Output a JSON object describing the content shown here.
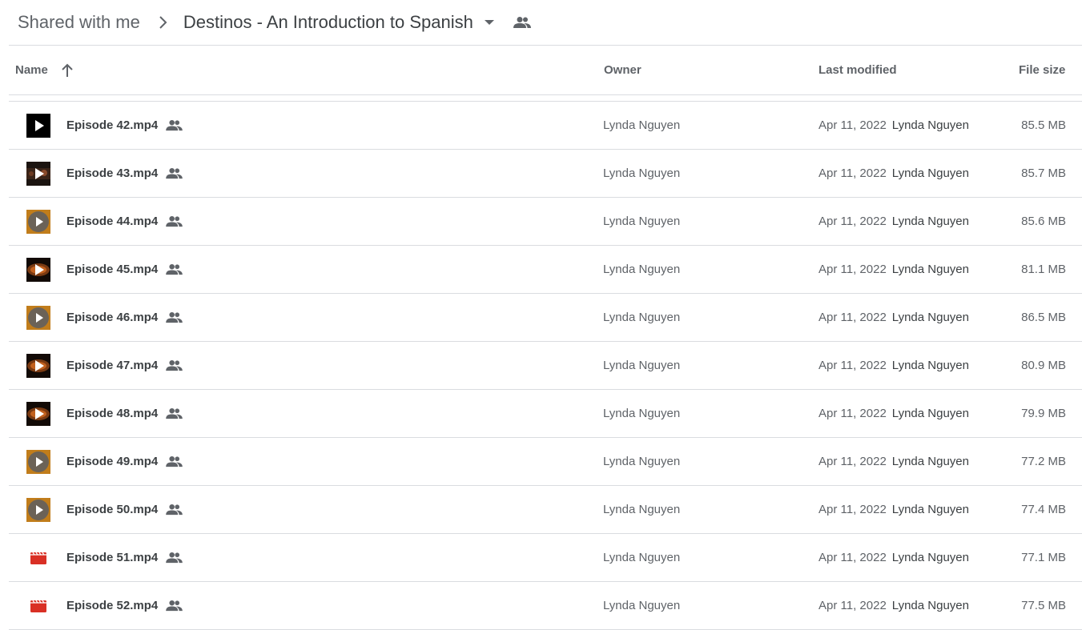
{
  "breadcrumb": {
    "root": "Shared with me",
    "current": "Destinos - An Introduction to Spanish"
  },
  "columns": {
    "name": "Name",
    "owner": "Owner",
    "last_modified": "Last modified",
    "file_size": "File size"
  },
  "icons": {
    "chevron": "chevron-right-icon",
    "dropdown": "arrow-drop-down-icon",
    "shared": "people-icon",
    "sort": "arrow-up-icon"
  },
  "files": [
    {
      "name": "Episode 42.mp4",
      "owner": "Lynda Nguyen",
      "date": "Apr 11, 2022",
      "by": "Lynda Nguyen",
      "size": "85.5 MB",
      "thumb": "black"
    },
    {
      "name": "Episode 43.mp4",
      "owner": "Lynda Nguyen",
      "date": "Apr 11, 2022",
      "by": "Lynda Nguyen",
      "size": "85.7 MB",
      "thumb": "scene"
    },
    {
      "name": "Episode 44.mp4",
      "owner": "Lynda Nguyen",
      "date": "Apr 11, 2022",
      "by": "Lynda Nguyen",
      "size": "85.6 MB",
      "thumb": "gold-circle"
    },
    {
      "name": "Episode 45.mp4",
      "owner": "Lynda Nguyen",
      "date": "Apr 11, 2022",
      "by": "Lynda Nguyen",
      "size": "81.1 MB",
      "thumb": "dark-orange"
    },
    {
      "name": "Episode 46.mp4",
      "owner": "Lynda Nguyen",
      "date": "Apr 11, 2022",
      "by": "Lynda Nguyen",
      "size": "86.5 MB",
      "thumb": "gold-circle"
    },
    {
      "name": "Episode 47.mp4",
      "owner": "Lynda Nguyen",
      "date": "Apr 11, 2022",
      "by": "Lynda Nguyen",
      "size": "80.9 MB",
      "thumb": "dark-orange"
    },
    {
      "name": "Episode 48.mp4",
      "owner": "Lynda Nguyen",
      "date": "Apr 11, 2022",
      "by": "Lynda Nguyen",
      "size": "79.9 MB",
      "thumb": "dark-orange"
    },
    {
      "name": "Episode 49.mp4",
      "owner": "Lynda Nguyen",
      "date": "Apr 11, 2022",
      "by": "Lynda Nguyen",
      "size": "77.2 MB",
      "thumb": "gold-circle"
    },
    {
      "name": "Episode 50.mp4",
      "owner": "Lynda Nguyen",
      "date": "Apr 11, 2022",
      "by": "Lynda Nguyen",
      "size": "77.4 MB",
      "thumb": "gold-circle"
    },
    {
      "name": "Episode 51.mp4",
      "owner": "Lynda Nguyen",
      "date": "Apr 11, 2022",
      "by": "Lynda Nguyen",
      "size": "77.1 MB",
      "thumb": "video-icon"
    },
    {
      "name": "Episode 52.mp4",
      "owner": "Lynda Nguyen",
      "date": "Apr 11, 2022",
      "by": "Lynda Nguyen",
      "size": "77.5 MB",
      "thumb": "video-icon"
    }
  ]
}
